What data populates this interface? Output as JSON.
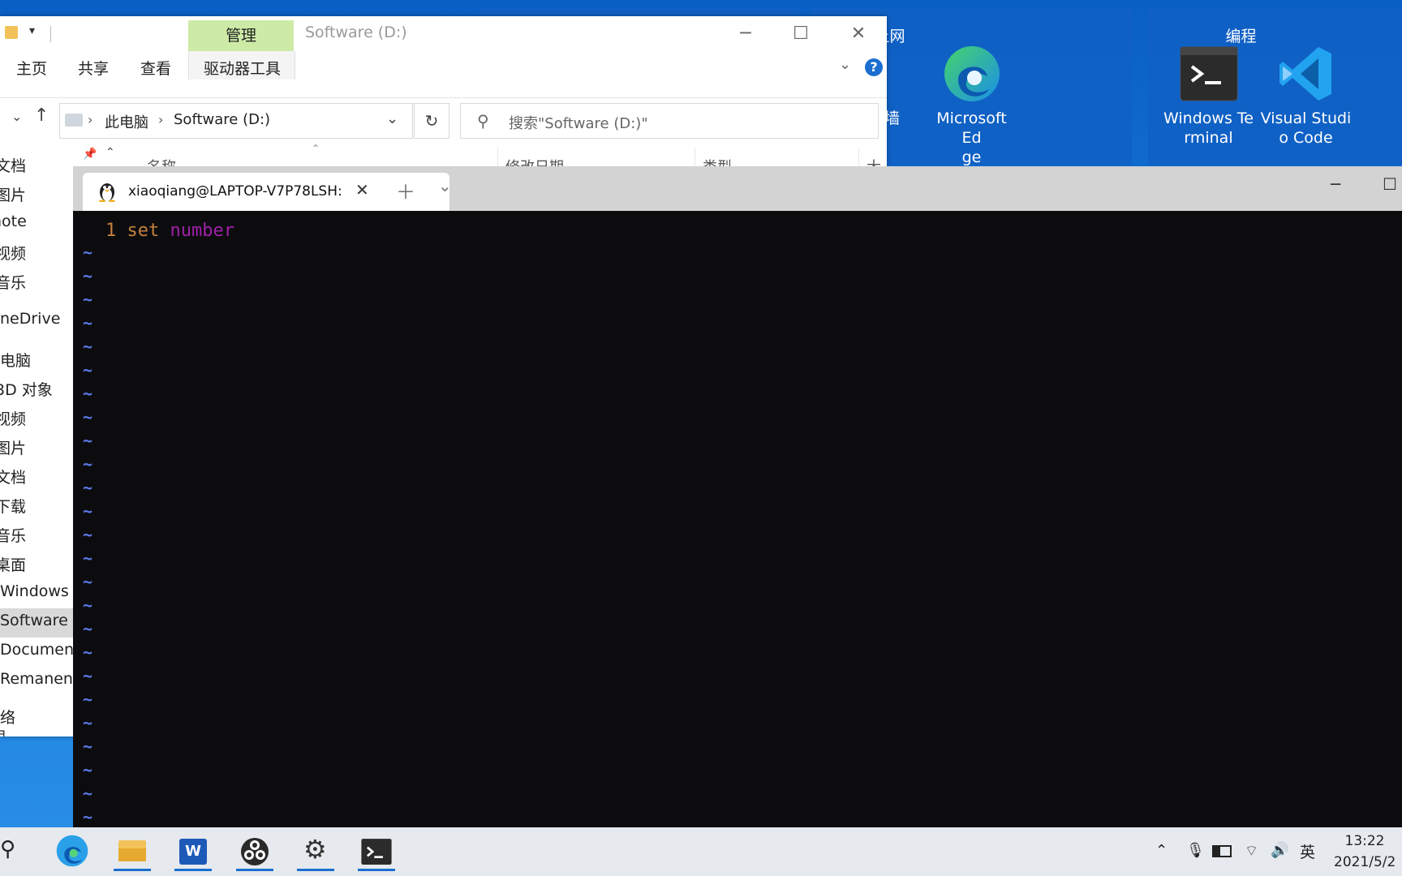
{
  "desktop": {
    "groups": [
      {
        "title": "上网"
      },
      {
        "title": "编程"
      }
    ],
    "icons": [
      {
        "label": "Microsoft Ed\nge",
        "icon": "edge-icon"
      },
      {
        "label": "Windows Te\nrminal",
        "icon": "terminal-icon"
      },
      {
        "label": "Visual Studi\no Code",
        "icon": "vscode-icon"
      }
    ],
    "partial_icon_label": "墙"
  },
  "explorer": {
    "context_tab": "管理",
    "title": "Software (D:)",
    "ribbon_tabs": [
      "主页",
      "共享",
      "查看",
      "驱动器工具"
    ],
    "breadcrumb": [
      "此电脑",
      "Software (D:)"
    ],
    "search_placeholder": "搜索\"Software (D:)\"",
    "columns": [
      "名称",
      "修改日期",
      "类型",
      "大小"
    ],
    "nav_items": [
      "文档",
      "图片",
      "note",
      "视频",
      "音乐",
      "neDrive",
      "电脑",
      "3D 对象",
      "视频",
      "图片",
      "文档",
      "下载",
      "音乐",
      "桌面",
      "Windows (C",
      "Software (D",
      "Document (",
      "Remanent (",
      "络",
      "目"
    ]
  },
  "terminal": {
    "tab_title": "xiaoqiang@LAPTOP-V7P78LSH:",
    "editor": {
      "line_number": "1",
      "keyword": "set",
      "option": "number",
      "tilde": "~",
      "tilde_count": 25
    },
    "colors": {
      "line_number": "#c6803d",
      "keyword": "#c6803d",
      "option": "#a020a8",
      "tilde": "#5c78e8",
      "background": "#0c0c0f"
    }
  },
  "taskbar": {
    "apps": [
      "edge",
      "file-explorer",
      "word",
      "obs",
      "settings",
      "terminal"
    ],
    "ime": "英",
    "time": "13:22",
    "date": "2021/5/2"
  }
}
